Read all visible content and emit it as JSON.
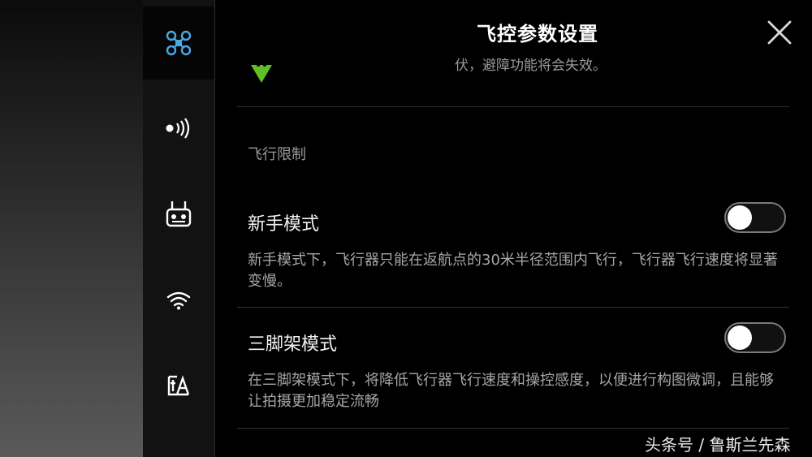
{
  "header": {
    "title": "飞控参数设置"
  },
  "sidebar": {
    "items": [
      {
        "name": "aircraft",
        "icon": "drone-icon",
        "active": true
      },
      {
        "name": "sensing",
        "icon": "signal-icon",
        "active": false
      },
      {
        "name": "remote",
        "icon": "remote-controller-icon",
        "active": false
      },
      {
        "name": "wifi",
        "icon": "wifi-icon",
        "active": false
      },
      {
        "name": "general",
        "icon": "text-sign-icon",
        "active": false
      }
    ]
  },
  "clipped": {
    "text": "伏，避障功能将会失效。",
    "icon": "arrow-down-icon",
    "icon_color": "#5fbf27"
  },
  "flight_limits": {
    "section_label": "飞行限制",
    "settings": [
      {
        "title": "新手模式",
        "desc": "新手模式下，飞行器只能在返航点的30米半径范围内飞行，飞行器飞行速度将显著变慢。",
        "enabled": false
      },
      {
        "title": "三脚架模式",
        "desc": "在三脚架模式下，将降低飞行器飞行速度和操控感度，以便进行构图微调，且能够让拍摄更加稳定流畅",
        "enabled": false
      }
    ]
  },
  "watermark": {
    "text": "头条号 / 鲁斯兰先森"
  },
  "colors": {
    "accent": "#4aa8e8",
    "background": "#000000",
    "divider": "#2f2f2f"
  }
}
